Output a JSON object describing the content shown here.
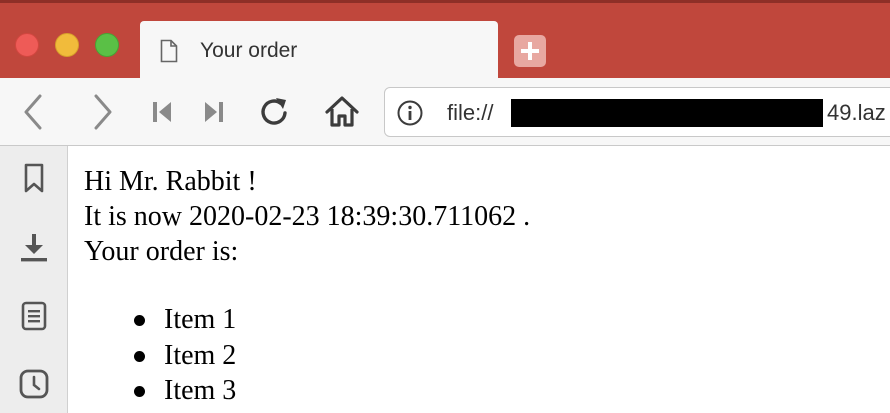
{
  "window": {
    "traffic_lights": [
      "close-button",
      "minimize-button",
      "zoom-button"
    ],
    "colors": {
      "titlebar": "#c0473c",
      "close": "#ee5b57",
      "minimize": "#f1bb3b",
      "zoom": "#5ac046"
    }
  },
  "tab": {
    "title": "Your order",
    "icon": "page-icon"
  },
  "toolbar": {
    "buttons": [
      "back-icon",
      "forward-icon",
      "skip-back-icon",
      "skip-forward-icon",
      "reload-icon",
      "home-icon"
    ],
    "url": {
      "prefix": "file://",
      "suffix": "49.laz"
    }
  },
  "sidebar": {
    "items": [
      "bookmark-icon",
      "download-icon",
      "reader-icon",
      "history-icon"
    ]
  },
  "content": {
    "greeting": "Hi Mr. Rabbit !",
    "time_line": "It is now 2020-02-23 18:39:30.711062 .",
    "order_intro": "Your order is:",
    "items": [
      "Item 1",
      "Item 2",
      "Item 3"
    ]
  }
}
